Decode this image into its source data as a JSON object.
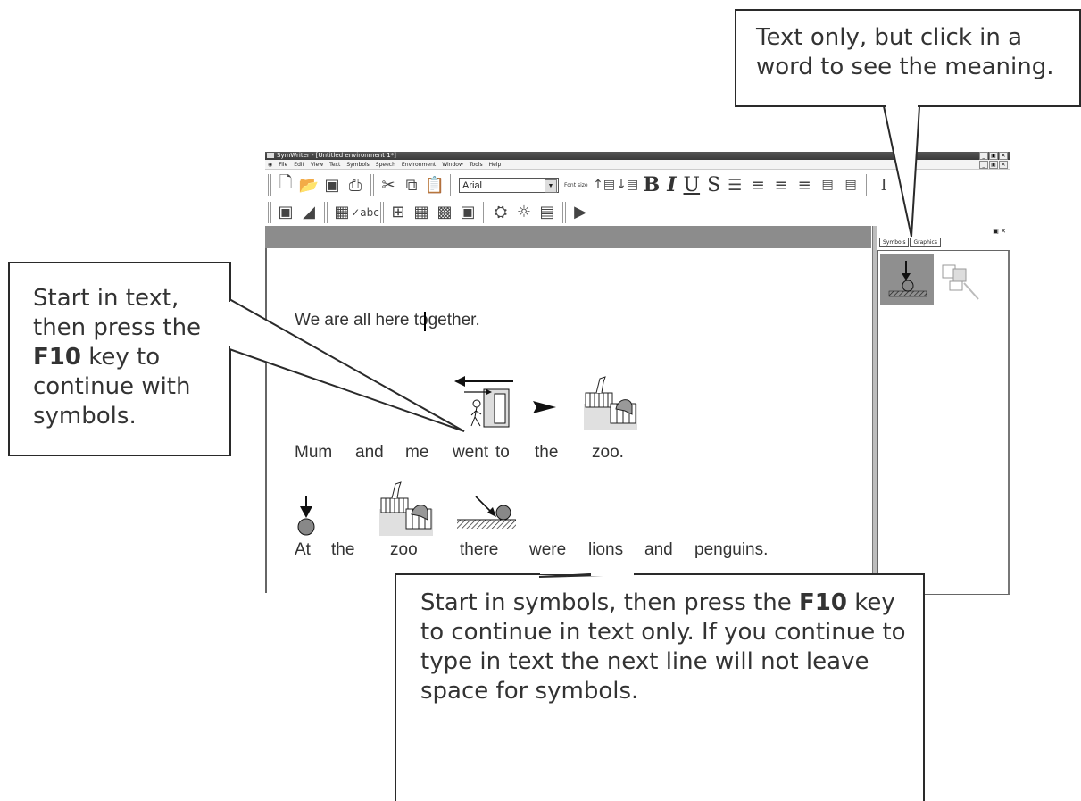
{
  "window": {
    "title": "SymWriter - [Untitled environment 1*]",
    "menu": [
      "File",
      "Edit",
      "View",
      "Text",
      "Symbols",
      "Speech",
      "Environment",
      "Window",
      "Tools",
      "Help"
    ]
  },
  "toolbar": {
    "font_name": "Arial",
    "font_size_label": "Font size",
    "bold": "B",
    "italic": "I",
    "underline": "U",
    "strike": "S"
  },
  "panel": {
    "tabs": [
      "Symbols",
      "Graphics"
    ]
  },
  "document": {
    "line1": "We are all here together.",
    "line2": [
      "Mum",
      "and",
      "me",
      "went",
      "to",
      "the",
      "zoo."
    ],
    "line3": [
      "At",
      "the",
      "zoo",
      "there",
      "were",
      "lions",
      "and",
      "penguins."
    ]
  },
  "callouts": {
    "top": "Text only, but click in a word to see the meaning.",
    "left_pre": "Start in text, then press the ",
    "left_key": "F10",
    "left_post": " key to continue with symbols.",
    "bottom_pre": "Start in symbols, then press the ",
    "bottom_key": "F10",
    "bottom_post": " key to continue in text only. If you continue to type in text the next line will not leave space for symbols."
  },
  "icons": [
    "new-doc",
    "open-folder",
    "save-disk",
    "print",
    "cut-scissors",
    "copy",
    "paste",
    "increase-size",
    "decrease-size",
    "bullets",
    "align-left",
    "align-center",
    "align-right",
    "text-cursor",
    "pointer",
    "play-speech"
  ],
  "colors": {
    "doc_strip": "#8c8c8c",
    "callout_border": "#2a2a2a"
  }
}
